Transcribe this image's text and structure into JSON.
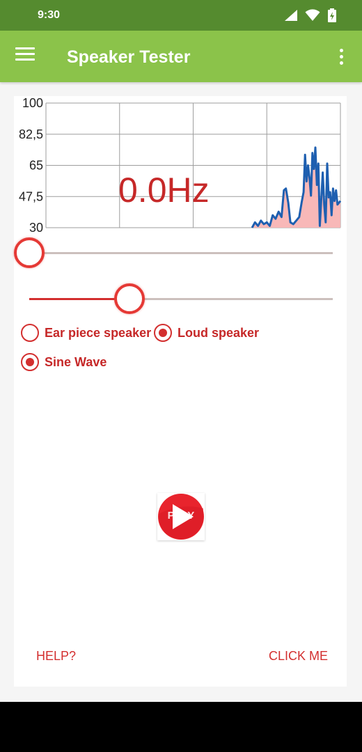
{
  "status": {
    "time": "9:30"
  },
  "app": {
    "title": "Speaker Tester"
  },
  "icons": {
    "menu": "hamburger-menu-icon",
    "overflow": "more-vertical-icon",
    "signal": "signal-icon",
    "wifi": "wifi-icon",
    "battery": "battery-charging-icon",
    "play": "play-icon"
  },
  "colors": {
    "status_bar": "#558b2f",
    "app_bar": "#8bc34a",
    "accent": "#d32f2f",
    "chart_line": "#1e5fb0",
    "chart_fill": "#f8b4b4"
  },
  "readout": {
    "frequency": "0.0Hz"
  },
  "sliders": [
    {
      "name": "frequency",
      "fraction": 0.0
    },
    {
      "name": "volume",
      "fraction": 0.33
    }
  ],
  "speaker_options": {
    "ear_piece": {
      "label": "Ear piece speaker",
      "selected": false
    },
    "loud": {
      "label": "Loud speaker",
      "selected": true
    }
  },
  "waveform_options": {
    "sine": {
      "label": "Sine Wave",
      "selected": true
    }
  },
  "play_button": {
    "label": "PLAY"
  },
  "footer": {
    "help": "HELP?",
    "click_me": "CLICK ME"
  },
  "chart_data": {
    "type": "area",
    "ylim": [
      30,
      100
    ],
    "y_ticks": [
      "100",
      "82,5",
      "65",
      "47,5",
      "30"
    ],
    "x_range": [
      0,
      100
    ],
    "grid": true,
    "series": [
      {
        "x": [
          70,
          71,
          72,
          73,
          74,
          75,
          76,
          77,
          78,
          79,
          80,
          80.8,
          81.5,
          82.3,
          83,
          84,
          85,
          86,
          86.8,
          87.5,
          88,
          88.5,
          89,
          89.5,
          90,
          90.5,
          91,
          91.5,
          92,
          92.5,
          93,
          93.5,
          94,
          94.5,
          95,
          95.5,
          96,
          96.5,
          97,
          97.5,
          98,
          98.5,
          99,
          100
        ],
        "y": [
          30,
          33,
          31,
          34,
          32,
          33,
          31,
          37,
          35,
          39,
          36,
          51,
          52,
          44,
          33,
          32,
          34,
          36,
          44,
          50,
          71,
          56,
          65,
          58,
          48,
          72,
          63,
          75,
          54,
          66,
          31,
          46,
          61,
          43,
          33,
          66,
          47,
          50,
          37,
          52,
          45,
          51,
          43,
          45
        ]
      }
    ]
  }
}
